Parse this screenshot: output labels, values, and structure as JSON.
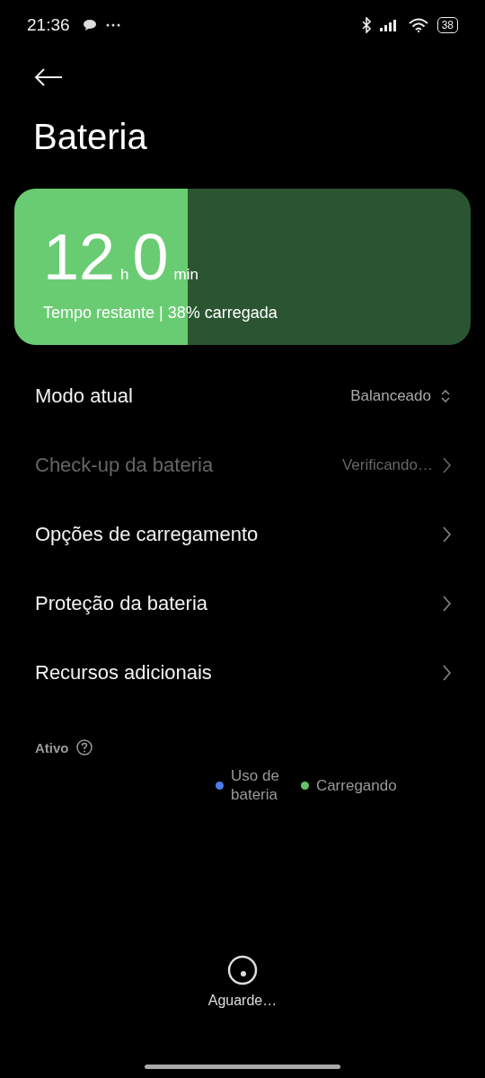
{
  "status_bar": {
    "time": "21:36",
    "battery": "38"
  },
  "title": "Bateria",
  "battery_card": {
    "level": 0.38,
    "hours": "12",
    "hours_unit": "h",
    "minutes": "0",
    "minutes_unit": "min",
    "caption": "Tempo restante | 38% carregada"
  },
  "settings": [
    {
      "kind": "select",
      "label": "Modo atual",
      "value": "Balanceado",
      "disabled": false
    },
    {
      "kind": "link",
      "label": "Check-up da bateria",
      "value": "Verificando…",
      "disabled": true
    },
    {
      "kind": "link",
      "label": "Opções de carregamento",
      "disabled": false
    },
    {
      "kind": "link",
      "label": "Proteção da bateria",
      "disabled": false
    },
    {
      "kind": "link",
      "label": "Recursos adicionais",
      "disabled": false
    }
  ],
  "activity": {
    "title": "Ativo",
    "legend": [
      {
        "label": "Uso de\nbateria",
        "color": "#4a7ee8"
      },
      {
        "label": "Carregando",
        "color": "#62c466"
      }
    ]
  },
  "loading": {
    "text": "Aguarde…"
  }
}
